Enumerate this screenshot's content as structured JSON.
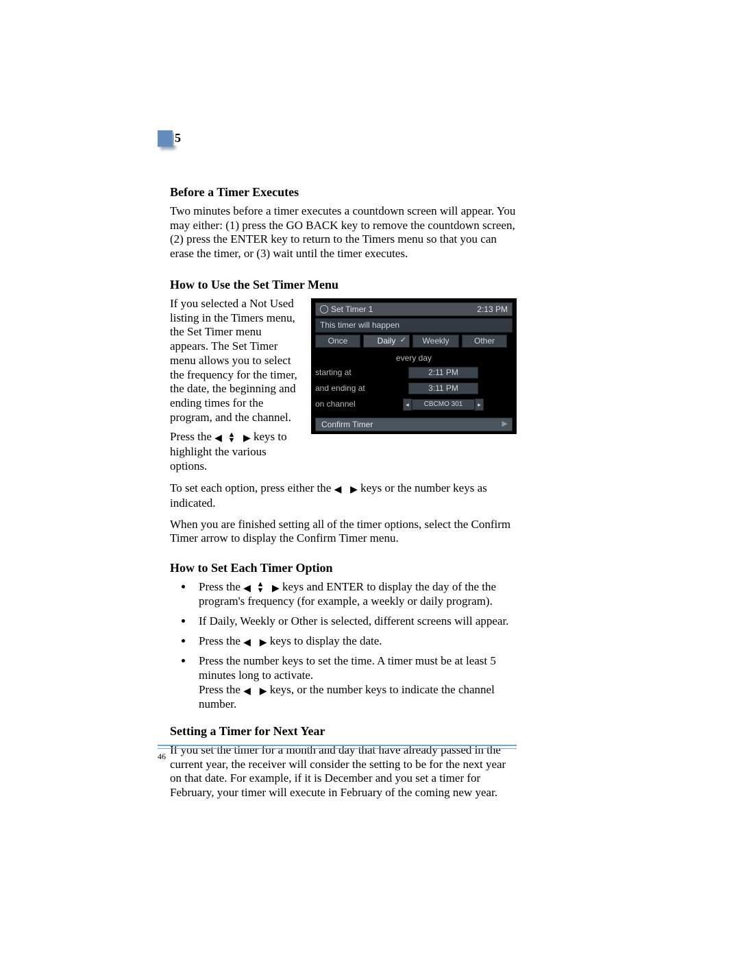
{
  "chapter_number": "5",
  "page_number": "46",
  "sections": {
    "s1": {
      "title": "Before a Timer Executes",
      "body": "Two minutes before a timer executes a countdown screen will appear. You may either: (1) press the GO BACK key to remove the countdown screen, (2) press the ENTER key to return to the Timers menu so that you can erase the timer, or (3) wait until the timer executes."
    },
    "s2": {
      "title": "How to Use the Set Timer Menu",
      "left_p1": "If you selected a Not Used listing in the Timers menu, the Set Timer menu appears. The Set Timer menu allows you to select the frequency for the timer, the date, the beginning and ending times for the program, and the channel.",
      "left_p2a": "Press the ",
      "left_p2b": " keys to highlight the various options.",
      "after_p1a": "To set each option, press either the ",
      "after_p1b": " keys or the number keys as indicated.",
      "after_p2": "When you are finished setting all of the timer options, select the Confirm Timer arrow to display the Confirm Timer menu."
    },
    "s3": {
      "title": "How to Set Each Timer Option",
      "b1a": "Press the ",
      "b1b": " keys and ENTER to display the day of the the program's frequency (for example, a weekly or daily program).",
      "b2": "If Daily, Weekly or Other is selected, different screens will appear.",
      "b3a": "Press the ",
      "b3b": " keys to display the date.",
      "b4a": "Press the number keys to set the time. A timer must be at least 5 minutes long to activate.",
      "b4b_pre": "Press the ",
      "b4b_post": " keys, or the number keys to indicate the channel number."
    },
    "s4": {
      "title": "Setting a Timer for Next Year",
      "body": "If you set the timer for a month and day that have already passed in the current year, the receiver will consider the setting to be for the next year on that date. For example, if it is December and you set a timer for February, your timer will execute in February of the coming new year."
    }
  },
  "ui": {
    "title": "Set Timer 1",
    "clock": "2:13 PM",
    "subhead": "This timer will happen",
    "freq": {
      "once": "Once",
      "daily": "Daily",
      "weekly": "Weekly",
      "other": "Other"
    },
    "every": "every day",
    "start_label": "starting at",
    "start_val": "2:11 PM",
    "end_label": "and ending at",
    "end_val": "3:11 PM",
    "chan_label": "on channel",
    "chan_val": "CBCMO 301",
    "confirm": "Confirm Timer"
  }
}
